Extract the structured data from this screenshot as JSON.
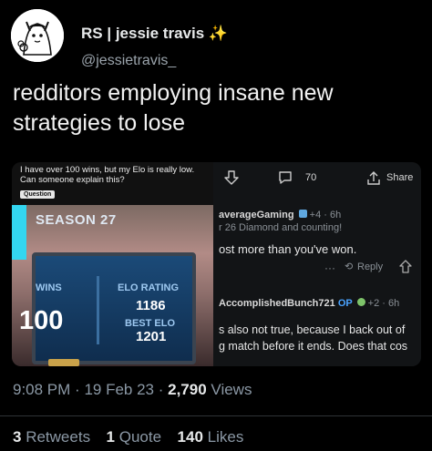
{
  "author": {
    "display_name": "RS | jessie travis",
    "sparkle": "✨",
    "handle": "@jessietravis_"
  },
  "tweet": {
    "text": "redditors employing insane new strategies to lose"
  },
  "screenshot": {
    "question": "I have over 100 wins, but my Elo is really low. Can someone explain this?",
    "badge": "Question",
    "season": "SEASON 27",
    "wins_label": "WINS",
    "wins_value": "100",
    "elo_label": "ELO RATING",
    "elo_value": "1186",
    "best_label": "BEST ELO",
    "best_value": "1201",
    "comment_count": "70",
    "share_label": "Share",
    "comment1_user": "averageGaming",
    "comment1_meta": "+4 · 6h",
    "comment1_flair": "r 26 Diamond and counting!",
    "comment1_text": "ost more than you've won.",
    "reply_label": "Reply",
    "comment2_user": "AccomplishedBunch721",
    "comment2_op": "OP",
    "comment2_meta": "+2 · 6h",
    "comment2_line1": "s also not true, because I back out of",
    "comment2_line2": "g match before it ends. Does that cos"
  },
  "meta": {
    "time": "9:08 PM",
    "date": "19 Feb 23",
    "views_count": "2,790",
    "views_label": "Views"
  },
  "stats": {
    "retweets_count": "3",
    "retweets_label": "Retweets",
    "quotes_count": "1",
    "quotes_label": "Quote",
    "likes_count": "140",
    "likes_label": "Likes"
  }
}
